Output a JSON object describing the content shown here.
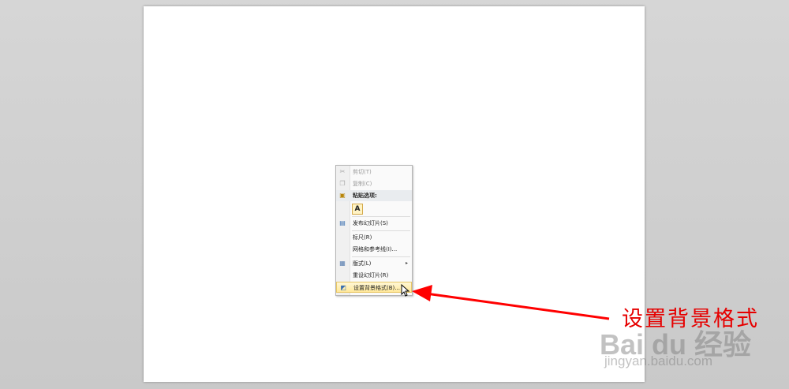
{
  "menu": {
    "items": [
      {
        "label": "剪切(T)",
        "icon": "scissors-icon",
        "state": "disabled"
      },
      {
        "label": "复制(C)",
        "icon": "copy-icon",
        "state": "disabled"
      },
      {
        "label": "粘贴选项:",
        "icon": "clipboard-icon",
        "state": "header"
      },
      {
        "label": "A",
        "icon": "paste-keep-text-icon",
        "state": "normal"
      },
      {
        "label": "发布幻灯片(S)",
        "icon": "publish-slides-icon",
        "state": "normal"
      },
      {
        "label": "标尺(R)",
        "icon": "",
        "state": "normal"
      },
      {
        "label": "网格和参考线(I)...",
        "icon": "",
        "state": "normal"
      },
      {
        "label": "版式(L)",
        "icon": "layout-icon",
        "state": "normal",
        "submenu_arrow": "▸"
      },
      {
        "label": "重设幻灯片(R)",
        "icon": "",
        "state": "normal"
      },
      {
        "label": "设置背景格式(B)...",
        "icon": "format-background-icon",
        "state": "highlighted"
      }
    ]
  },
  "annotation": {
    "caption": "设置背景格式",
    "arrow_color": "#ff0000"
  },
  "watermark": {
    "brand": "Bai du 经验",
    "url": "jingyan.baidu.com"
  },
  "colors": {
    "highlight_bg": "#ffe89a",
    "caption_red": "#e60000"
  }
}
